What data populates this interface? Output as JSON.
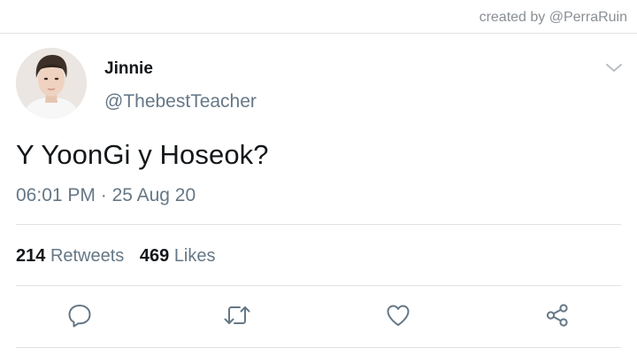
{
  "credit": "created by @PerraRuin",
  "tweet": {
    "author_name": "Jinnie",
    "author_handle": "@ThebestTeacher",
    "text": "Y YoonGi y Hoseok?",
    "time": "06:01 PM",
    "separator": "·",
    "date": "25 Aug 20",
    "retweets_count": "214",
    "retweets_label": "Retweets",
    "likes_count": "469",
    "likes_label": "Likes"
  },
  "icons": {
    "menu": "chevron-down-icon",
    "reply": "reply-icon",
    "retweet": "retweet-icon",
    "like": "heart-icon",
    "share": "share-icon"
  },
  "colors": {
    "text_primary": "#14171a",
    "text_secondary": "#657786",
    "icon": "#657786",
    "divider": "#dfe3e6"
  }
}
